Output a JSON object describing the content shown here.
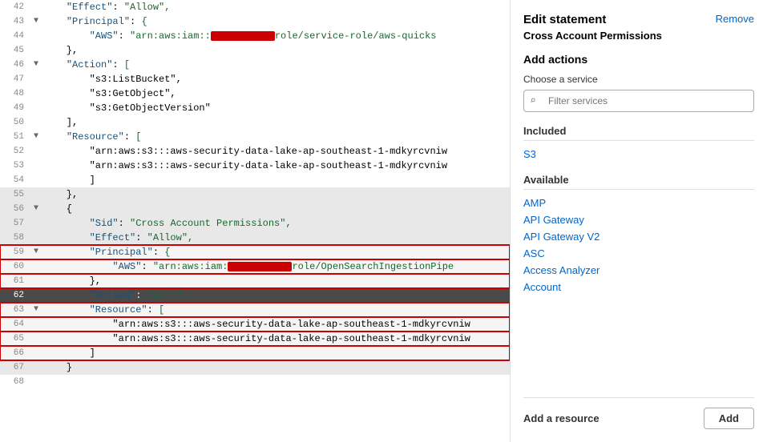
{
  "header": {
    "title": "Edit statement",
    "subtitle": "Cross Account Permissions",
    "remove_label": "Remove"
  },
  "add_actions": {
    "section_title": "Add actions",
    "choose_service_label": "Choose a service",
    "filter_placeholder": "Filter services"
  },
  "included": {
    "label": "Included",
    "items": [
      "S3"
    ]
  },
  "available": {
    "label": "Available",
    "items": [
      "AMP",
      "API Gateway",
      "API Gateway V2",
      "ASC",
      "Access Analyzer",
      "Account"
    ]
  },
  "add_resource": {
    "label": "Add a resource",
    "button_label": "Add"
  },
  "code": {
    "lines": [
      {
        "num": "42",
        "toggle": "",
        "indent": 4,
        "content": "\"Effect\": \"Allow\",",
        "highlight": false,
        "active": false,
        "redbox": false
      },
      {
        "num": "43",
        "toggle": "▼",
        "indent": 4,
        "content": "\"Principal\": {",
        "highlight": false,
        "active": false,
        "redbox": false
      },
      {
        "num": "44",
        "toggle": "",
        "indent": 8,
        "content": "\"AWS\": \"arn:aws:iam::",
        "highlight": false,
        "active": false,
        "redbox": false,
        "redacted": true,
        "after": "role/service-role/aws-quicks"
      },
      {
        "num": "45",
        "toggle": "",
        "indent": 4,
        "content": "},",
        "highlight": false,
        "active": false,
        "redbox": false
      },
      {
        "num": "46",
        "toggle": "▼",
        "indent": 4,
        "content": "\"Action\": [",
        "highlight": false,
        "active": false,
        "redbox": false
      },
      {
        "num": "47",
        "toggle": "",
        "indent": 8,
        "content": "\"s3:ListBucket\",",
        "highlight": false,
        "active": false,
        "redbox": false
      },
      {
        "num": "48",
        "toggle": "",
        "indent": 8,
        "content": "\"s3:GetObject\",",
        "highlight": false,
        "active": false,
        "redbox": false
      },
      {
        "num": "49",
        "toggle": "",
        "indent": 8,
        "content": "\"s3:GetObjectVersion\"",
        "highlight": false,
        "active": false,
        "redbox": false
      },
      {
        "num": "50",
        "toggle": "",
        "indent": 4,
        "content": "],",
        "highlight": false,
        "active": false,
        "redbox": false
      },
      {
        "num": "51",
        "toggle": "▼",
        "indent": 4,
        "content": "\"Resource\": [",
        "highlight": false,
        "active": false,
        "redbox": false
      },
      {
        "num": "52",
        "toggle": "",
        "indent": 8,
        "content": "\"arn:aws:s3:::aws-security-data-lake-ap-southeast-1-mdkyrcvniw",
        "highlight": false,
        "active": false,
        "redbox": false
      },
      {
        "num": "53",
        "toggle": "",
        "indent": 8,
        "content": "\"arn:aws:s3:::aws-security-data-lake-ap-southeast-1-mdkyrcvniw",
        "highlight": false,
        "active": false,
        "redbox": false
      },
      {
        "num": "54",
        "toggle": "",
        "indent": 8,
        "content": "]",
        "highlight": false,
        "active": false,
        "redbox": false
      },
      {
        "num": "55",
        "toggle": "",
        "indent": 4,
        "content": "},",
        "highlight": true,
        "active": false,
        "redbox": false
      },
      {
        "num": "56",
        "toggle": "▼",
        "indent": 4,
        "content": "{",
        "highlight": true,
        "active": false,
        "redbox": false
      },
      {
        "num": "57",
        "toggle": "",
        "indent": 8,
        "content": "\"Sid\": \"Cross Account Permissions\",",
        "highlight": true,
        "active": false,
        "redbox": false
      },
      {
        "num": "58",
        "toggle": "",
        "indent": 8,
        "content": "\"Effect\": \"Allow\",",
        "highlight": true,
        "active": false,
        "redbox": false
      },
      {
        "num": "59",
        "toggle": "▼",
        "indent": 8,
        "content": "\"Principal\": {",
        "highlight": true,
        "active": false,
        "redbox": true
      },
      {
        "num": "60",
        "toggle": "",
        "indent": 12,
        "content": "\"AWS\": \"arn:aws:iam:",
        "highlight": true,
        "active": false,
        "redbox": true,
        "redacted": true,
        "after": "role/OpenSearchIngestionPipe"
      },
      {
        "num": "61",
        "toggle": "",
        "indent": 8,
        "content": "},",
        "highlight": true,
        "active": false,
        "redbox": true
      },
      {
        "num": "62",
        "toggle": "",
        "indent": 8,
        "content": "\"Action\": \"s3:*\",",
        "highlight": false,
        "active": true,
        "redbox": false
      },
      {
        "num": "63",
        "toggle": "▼",
        "indent": 8,
        "content": "\"Resource\": [",
        "highlight": true,
        "active": false,
        "redbox": true
      },
      {
        "num": "64",
        "toggle": "",
        "indent": 12,
        "content": "\"arn:aws:s3:::aws-security-data-lake-ap-southeast-1-mdkyrcvniw",
        "highlight": true,
        "active": false,
        "redbox": true
      },
      {
        "num": "65",
        "toggle": "",
        "indent": 12,
        "content": "\"arn:aws:s3:::aws-security-data-lake-ap-southeast-1-mdkyrcvniw",
        "highlight": true,
        "active": false,
        "redbox": true
      },
      {
        "num": "66",
        "toggle": "",
        "indent": 8,
        "content": "]",
        "highlight": true,
        "active": false,
        "redbox": true
      },
      {
        "num": "67",
        "toggle": "",
        "indent": 4,
        "content": "}",
        "highlight": true,
        "active": false,
        "redbox": false
      },
      {
        "num": "68",
        "toggle": "",
        "indent": 0,
        "content": "",
        "highlight": false,
        "active": false,
        "redbox": false
      }
    ]
  }
}
